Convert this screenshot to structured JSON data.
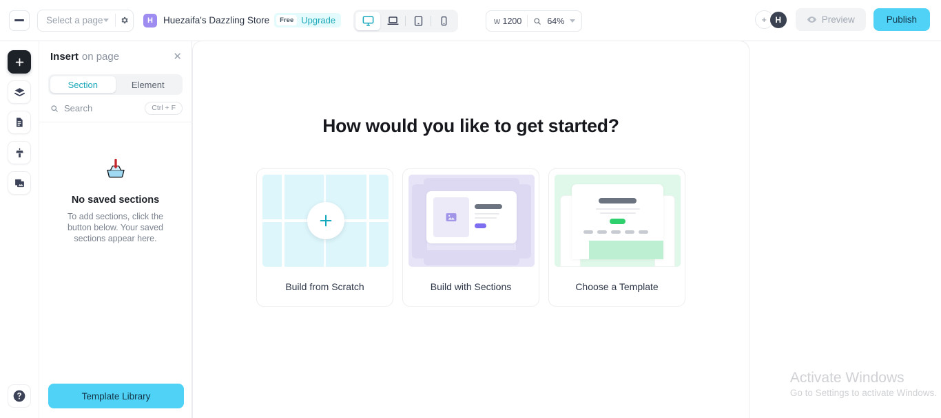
{
  "topbar": {
    "menu_icon": "hamburger-icon",
    "page_select": {
      "placeholder": "Select a page",
      "settings_icon": "gear-icon",
      "caret_icon": "chevron-down-icon"
    },
    "store": {
      "avatar_initial": "H",
      "name": "Huezaifa's Dazzling Store",
      "plan_badge": "Free",
      "upgrade_label": "Upgrade"
    },
    "devices": [
      {
        "name": "desktop",
        "icon": "desktop-icon",
        "active": true
      },
      {
        "name": "laptop",
        "icon": "laptop-icon",
        "active": false
      },
      {
        "name": "tablet",
        "icon": "tablet-icon",
        "active": false
      },
      {
        "name": "mobile",
        "icon": "mobile-icon",
        "active": false
      }
    ],
    "viewport": {
      "width_prefix": "w",
      "width_value": "1200",
      "zoom_icon": "magnifier-icon",
      "zoom_value": "64%",
      "caret_icon": "chevron-down-icon"
    },
    "collaborators": {
      "add_label": "+",
      "avatar_initial": "H"
    },
    "preview_label": "Preview",
    "preview_icon": "eye-icon",
    "publish_label": "Publish"
  },
  "rail": {
    "items": [
      {
        "name": "add",
        "icon": "plus-icon"
      },
      {
        "name": "layers",
        "icon": "layers-icon"
      },
      {
        "name": "pages",
        "icon": "document-icon"
      },
      {
        "name": "theme",
        "icon": "paint-brush-icon"
      },
      {
        "name": "media",
        "icon": "media-stack-icon"
      }
    ],
    "help_icon": "question-circle-icon"
  },
  "panel": {
    "title": "Insert",
    "title_suffix": "on page",
    "close_icon": "close-icon",
    "tabs": [
      {
        "label": "Section",
        "active": true
      },
      {
        "label": "Element",
        "active": false
      }
    ],
    "search": {
      "icon": "search-icon",
      "placeholder": "Search",
      "shortcut": "Ctrl + F"
    },
    "empty_state": {
      "icon": "inbox-download-icon",
      "title": "No saved sections",
      "description": "To add sections, click the button below. Your saved sections appear here."
    },
    "template_library_label": "Template Library"
  },
  "canvas": {
    "title": "How would you like to get started?",
    "cards": [
      {
        "label": "Build from Scratch",
        "thumb": "grid-plus-thumbnail",
        "accent": "#1aa7b8"
      },
      {
        "label": "Build with Sections",
        "thumb": "sections-thumbnail",
        "accent": "#7d6df0"
      },
      {
        "label": "Choose a Template",
        "thumb": "template-thumbnail",
        "accent": "#2ed06e"
      }
    ]
  },
  "watermark": {
    "title": "Activate Windows",
    "subtitle": "Go to Settings to activate Windows."
  }
}
